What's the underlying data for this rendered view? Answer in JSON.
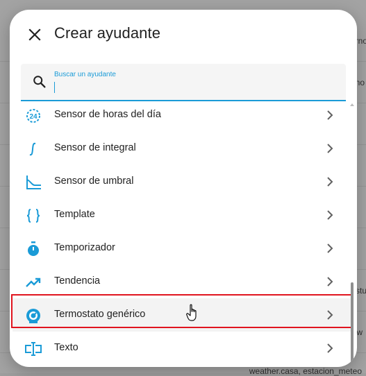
{
  "dialog": {
    "title": "Crear ayudante",
    "close_icon": "close-icon"
  },
  "search": {
    "label": "Buscar un ayudante",
    "value": "",
    "icon": "search-icon"
  },
  "list": {
    "items": [
      {
        "label": "Sensor de horas del día",
        "icon": "clock-24-icon"
      },
      {
        "label": "Sensor de integral",
        "icon": "integral-icon"
      },
      {
        "label": "Sensor de umbral",
        "icon": "threshold-icon"
      },
      {
        "label": "Template",
        "icon": "code-braces-icon"
      },
      {
        "label": "Temporizador",
        "icon": "timer-icon"
      },
      {
        "label": "Tendencia",
        "icon": "trending-up-icon"
      },
      {
        "label": "Termostato genérico",
        "icon": "thermostat-icon",
        "highlighted": true
      },
      {
        "label": "Texto",
        "icon": "text-field-icon"
      }
    ]
  },
  "background": {
    "fragments": [
      "rno",
      "no",
      "stu",
      "w",
      "weather.casa, estacion_meteo"
    ]
  },
  "colors": {
    "accent": "#1a9bd7",
    "highlight_border": "#e0141e",
    "scrim": "#a3a3a3"
  }
}
